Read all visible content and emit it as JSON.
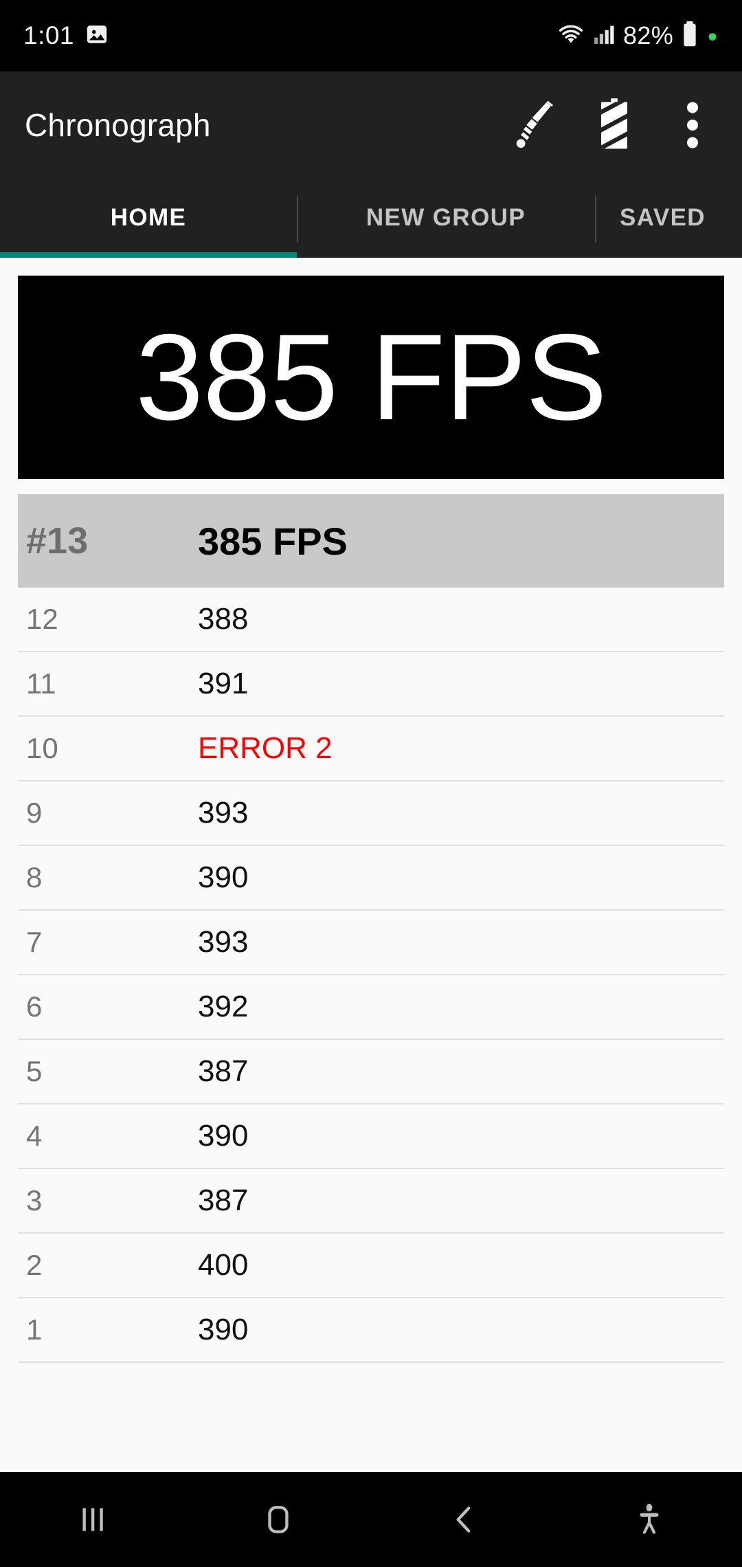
{
  "status_bar": {
    "clock": "1:01",
    "icons_left": [
      "image-icon"
    ],
    "icons_right": [
      "wifi-icon",
      "cellular-signal-icon"
    ],
    "battery_percent": "82%",
    "battery_icon": "battery-icon",
    "indicator_color": "#2fd95c"
  },
  "app_bar": {
    "title": "Chronograph",
    "actions": [
      {
        "name": "bb-weight-icon",
        "label": "bb-weight"
      },
      {
        "name": "battery-meter-icon",
        "label": "battery-meter"
      },
      {
        "name": "overflow-menu-icon",
        "label": "more-options"
      }
    ]
  },
  "tabs": {
    "items": [
      {
        "label": "HOME",
        "active": true
      },
      {
        "label": "NEW GROUP",
        "active": false
      },
      {
        "label": "SAVED",
        "active": false
      }
    ],
    "indicator_color": "#00897b"
  },
  "readout": {
    "value": "385 FPS",
    "background": "#000000",
    "text_color": "#ffffff"
  },
  "shot_list": {
    "current": {
      "index": "#13",
      "value": "385 FPS"
    },
    "rows": [
      {
        "index": "12",
        "value": "388",
        "error": false
      },
      {
        "index": "11",
        "value": "391",
        "error": false
      },
      {
        "index": "10",
        "value": "ERROR 2",
        "error": true
      },
      {
        "index": "9",
        "value": "393",
        "error": false
      },
      {
        "index": "8",
        "value": "390",
        "error": false
      },
      {
        "index": "7",
        "value": "393",
        "error": false
      },
      {
        "index": "6",
        "value": "392",
        "error": false
      },
      {
        "index": "5",
        "value": "387",
        "error": false
      },
      {
        "index": "4",
        "value": "390",
        "error": false
      },
      {
        "index": "3",
        "value": "387",
        "error": false
      },
      {
        "index": "2",
        "value": "400",
        "error": false
      },
      {
        "index": "1",
        "value": "390",
        "error": false
      }
    ],
    "error_color": "#ff0000",
    "highlight_color": "#c9c9c9"
  },
  "nav_bar": {
    "buttons": [
      {
        "name": "recents-icon",
        "label": "Recents"
      },
      {
        "name": "home-icon",
        "label": "Home"
      },
      {
        "name": "back-icon",
        "label": "Back"
      },
      {
        "name": "accessibility-icon",
        "label": "Accessibility"
      }
    ]
  }
}
